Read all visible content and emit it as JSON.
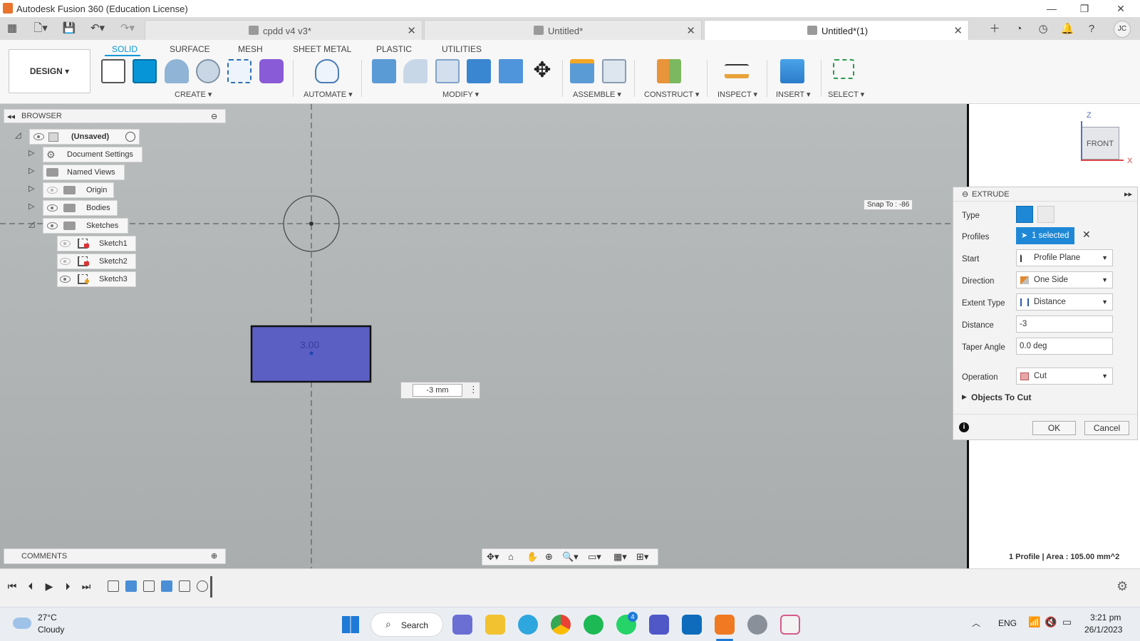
{
  "window": {
    "title": "Autodesk Fusion 360 (Education License)",
    "minimize": "—",
    "restore": "❐",
    "close": "✕"
  },
  "doc_tabs": [
    {
      "label": "cpdd v4 v3*",
      "close": "✕"
    },
    {
      "label": "Untitled*",
      "close": "✕"
    },
    {
      "label": "Untitled*(1)",
      "close": "✕"
    }
  ],
  "user_initials": "JC",
  "workspace": {
    "label": "DESIGN ▾"
  },
  "ribbon_tabs": [
    "SOLID",
    "SURFACE",
    "MESH",
    "SHEET METAL",
    "PLASTIC",
    "UTILITIES"
  ],
  "ribbon_groups": [
    "CREATE ▾",
    "AUTOMATE ▾",
    "MODIFY ▾",
    "ASSEMBLE ▾",
    "CONSTRUCT ▾",
    "INSPECT ▾",
    "INSERT ▾",
    "SELECT ▾"
  ],
  "browser": {
    "title": "BROWSER",
    "root": "(Unsaved)",
    "items": [
      "Document Settings",
      "Named Views",
      "Origin",
      "Bodies",
      "Sketches"
    ],
    "sketches": [
      "Sketch1",
      "Sketch2",
      "Sketch3"
    ]
  },
  "comments": {
    "title": "COMMENTS"
  },
  "canvas": {
    "snap_tooltip": "Snap To : -86",
    "sketch_dim": "3.00",
    "distance_manip": "-3 mm"
  },
  "viewcube": {
    "face": "FRONT",
    "axis_z": "Z",
    "axis_x": "X"
  },
  "extrude": {
    "title": "EXTRUDE",
    "type_label": "Type",
    "profiles_label": "Profiles",
    "profiles_value": "1 selected",
    "start_label": "Start",
    "start_value": "Profile Plane",
    "direction_label": "Direction",
    "direction_value": "One Side",
    "extent_label": "Extent Type",
    "extent_value": "Distance",
    "distance_label": "Distance",
    "distance_value": "-3",
    "taper_label": "Taper Angle",
    "taper_value": "0.0 deg",
    "operation_label": "Operation",
    "operation_value": "Cut",
    "objects_to_cut": "Objects To Cut",
    "ok": "OK",
    "cancel": "Cancel"
  },
  "status": {
    "profile_area": "1 Profile | Area : 105.00 mm^2"
  },
  "taskbar": {
    "weather_temp": "27°C",
    "weather_desc": "Cloudy",
    "search": "Search",
    "teams_badge": "4",
    "lang": "ENG",
    "time": "3:21 pm",
    "date": "26/1/2023"
  }
}
